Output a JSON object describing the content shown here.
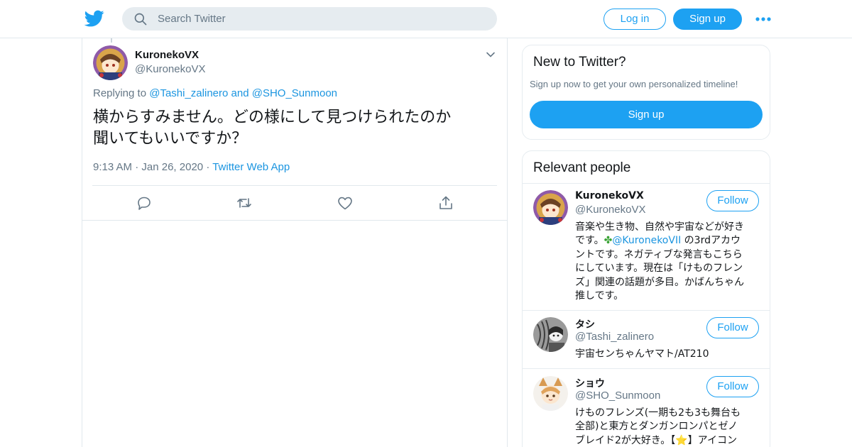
{
  "header": {
    "logo_icon": "twitter-bird-icon",
    "search_placeholder": "Search Twitter",
    "login_label": "Log in",
    "signup_label": "Sign up",
    "more_icon": "more-dots-icon",
    "brand_color": "#1da1f2"
  },
  "tweet": {
    "author_name": "KuronekoVX",
    "author_handle": "@KuronekoVX",
    "replying_prefix": "Replying to",
    "reply_to_1": "@Tashi_zalinero",
    "reply_and": "and",
    "reply_to_2": "@SHO_Sunmoon",
    "text_line1": "横からすみません。どの様にして見つけられたのか",
    "text_line2": "聞いてもいいですか？",
    "time": "9:13 AM",
    "date": "Jan 26, 2020",
    "source": "Twitter Web App",
    "separator": "·",
    "actions": [
      "reply-icon",
      "retweet-icon",
      "like-icon",
      "share-icon"
    ]
  },
  "sidebar": {
    "new": {
      "title": "New to Twitter?",
      "subtitle": "Sign up now to get your own personalized timeline!",
      "button": "Sign up"
    },
    "people": {
      "title": "Relevant people",
      "follow_label": "Follow",
      "items": [
        {
          "name": "KuronekoVX",
          "handle": "@KuronekoVX",
          "bio_1": "音楽や生き物、自然や宇宙などが好き",
          "bio_2a": "です。",
          "bio_2_emoji": "✤",
          "bio_2_link": "@KuronekoVII",
          "bio_2b": " の3rdアカウ",
          "bio_3": "ントです。ネガティブな発言もこちら",
          "bio_4": "にしています。現在は「けものフレン",
          "bio_5": "ズ」関連の話題が多目。かばんちゃん",
          "bio_6": "推しです。"
        },
        {
          "name": "タシ",
          "handle": "@Tashi_zalinero",
          "bio_1": "宇宙センちゃんヤマト/AT210"
        },
        {
          "name": "ショウ",
          "handle": "@SHO_Sunmoon",
          "bio_1": "けものフレンズ(一期も2も3も舞台も",
          "bio_2": "全部)と東方とダンガンロンパとゼノ",
          "bio_3": "ブレイド2が大好き。【⭐】アイコン"
        }
      ]
    }
  }
}
